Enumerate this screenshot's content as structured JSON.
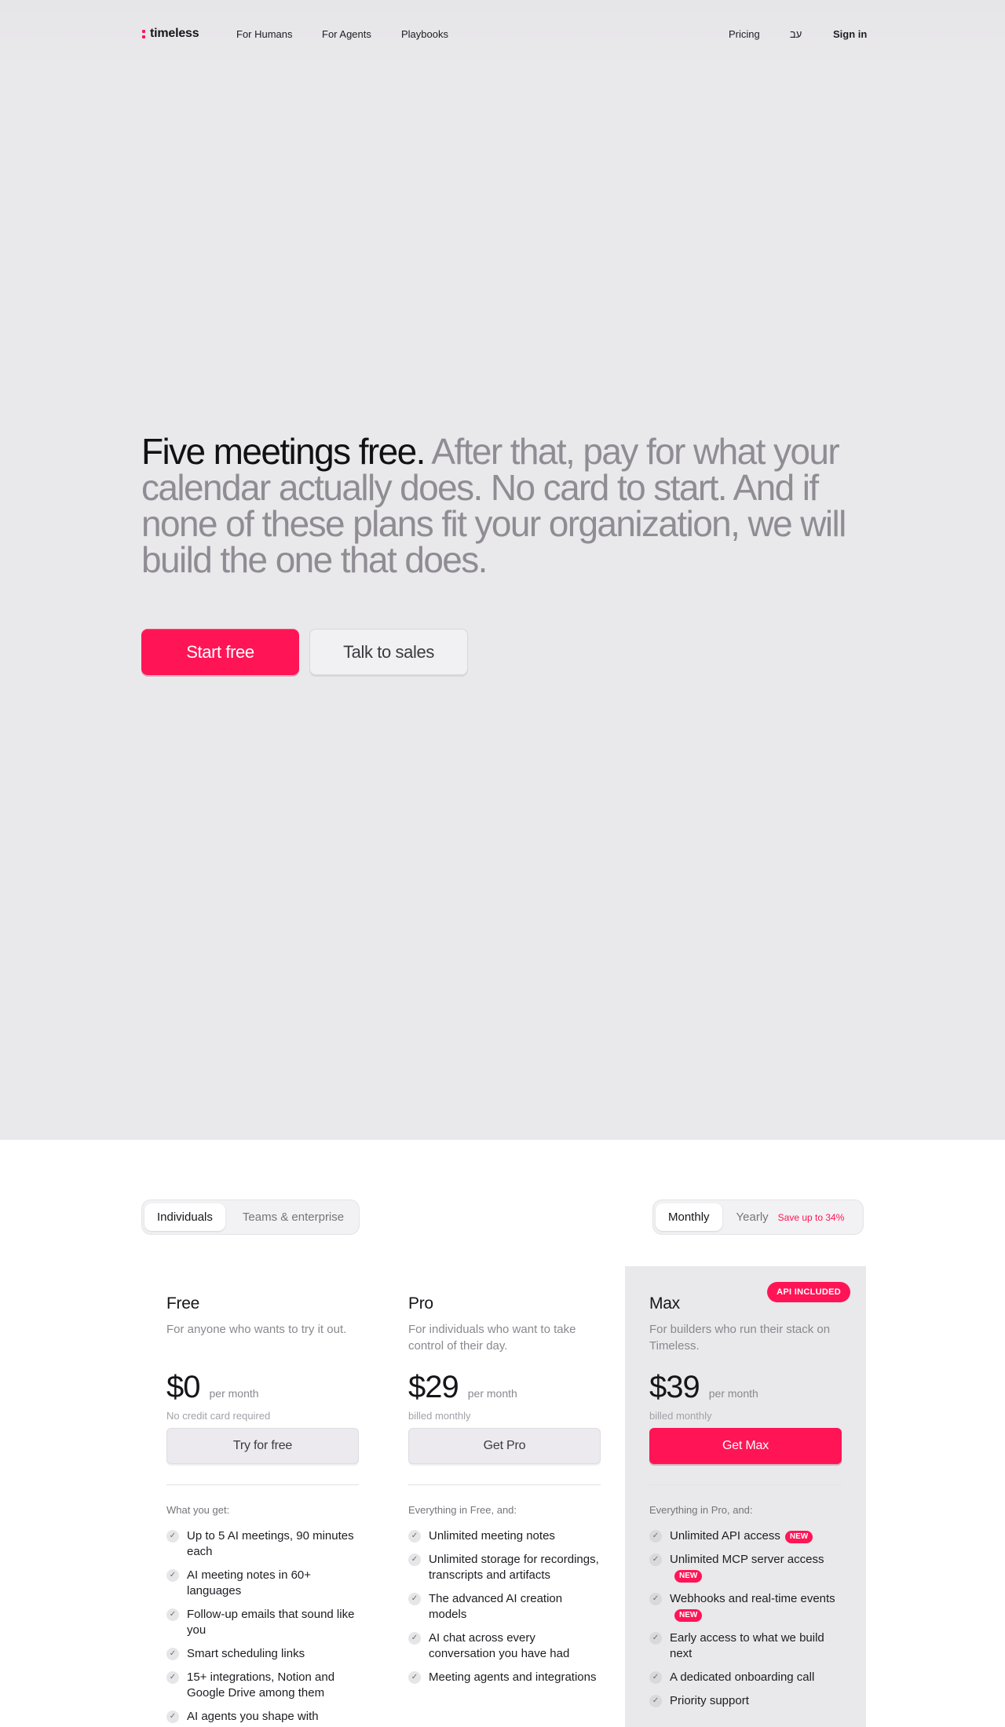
{
  "nav": {
    "logo": "timeless",
    "links": [
      "For Humans",
      "For Agents",
      "Playbooks"
    ],
    "pricing": "Pricing",
    "language": "עב",
    "sign_in": "Sign in"
  },
  "hero": {
    "headline_strong": "Five meetings free.",
    "headline_rest": " After that, pay for what your calendar actually does. No card to start. And if none of these plans fit your organization, we will build the one that does.",
    "primary_cta": "Start free",
    "secondary_cta": "Talk to sales"
  },
  "audience_toggle": {
    "options": [
      "Individuals",
      "Teams & enterprise"
    ],
    "selected": "Individuals"
  },
  "billing_toggle": {
    "options": [
      "Monthly",
      "Yearly"
    ],
    "selected": "Monthly",
    "save_label": "Save up to 34%"
  },
  "plans": [
    {
      "name": "Free",
      "description": "For anyone who wants to try it out.",
      "price": "$0",
      "period": "per month",
      "note": "No credit card required",
      "cta": "Try for free",
      "features_heading": "What you get:",
      "features": [
        {
          "text": "Up to 5 AI meetings, 90 minutes each"
        },
        {
          "text": "AI meeting notes in 60+ languages"
        },
        {
          "text": "Follow-up emails that sound like you"
        },
        {
          "text": "Smart scheduling links"
        },
        {
          "text": "15+ integrations, Notion and Google Drive among them"
        },
        {
          "text": "AI agents you shape with"
        }
      ]
    },
    {
      "name": "Pro",
      "description": "For individuals who want to take control of their day.",
      "price": "$29",
      "period": "per month",
      "note": "billed monthly",
      "cta": "Get Pro",
      "features_heading": "Everything in Free, and:",
      "features": [
        {
          "text": "Unlimited meeting notes"
        },
        {
          "text": "Unlimited storage for recordings, transcripts and artifacts"
        },
        {
          "text": "The advanced AI creation models"
        },
        {
          "text": "AI chat across every conversation you have had"
        },
        {
          "text": "Meeting agents and integrations"
        }
      ]
    },
    {
      "name": "Max",
      "badge": "API INCLUDED",
      "description": "For builders who run their stack on Timeless.",
      "price": "$39",
      "period": "per month",
      "note": "billed monthly",
      "cta": "Get Max",
      "features_heading": "Everything in Pro, and:",
      "features": [
        {
          "text": "Unlimited API access",
          "badge": "NEW"
        },
        {
          "text": "Unlimited MCP server access",
          "badge": "NEW"
        },
        {
          "text": "Webhooks and real-time events",
          "badge": "NEW"
        },
        {
          "text": "Early access to what we build next"
        },
        {
          "text": "A dedicated onboarding call"
        },
        {
          "text": "Priority support"
        }
      ]
    }
  ],
  "icons": {
    "check": "check-icon",
    "logo": "timeless-logo-icon"
  },
  "colors": {
    "accent": "#ff1556",
    "hero_bg": "#e9e8eb"
  }
}
